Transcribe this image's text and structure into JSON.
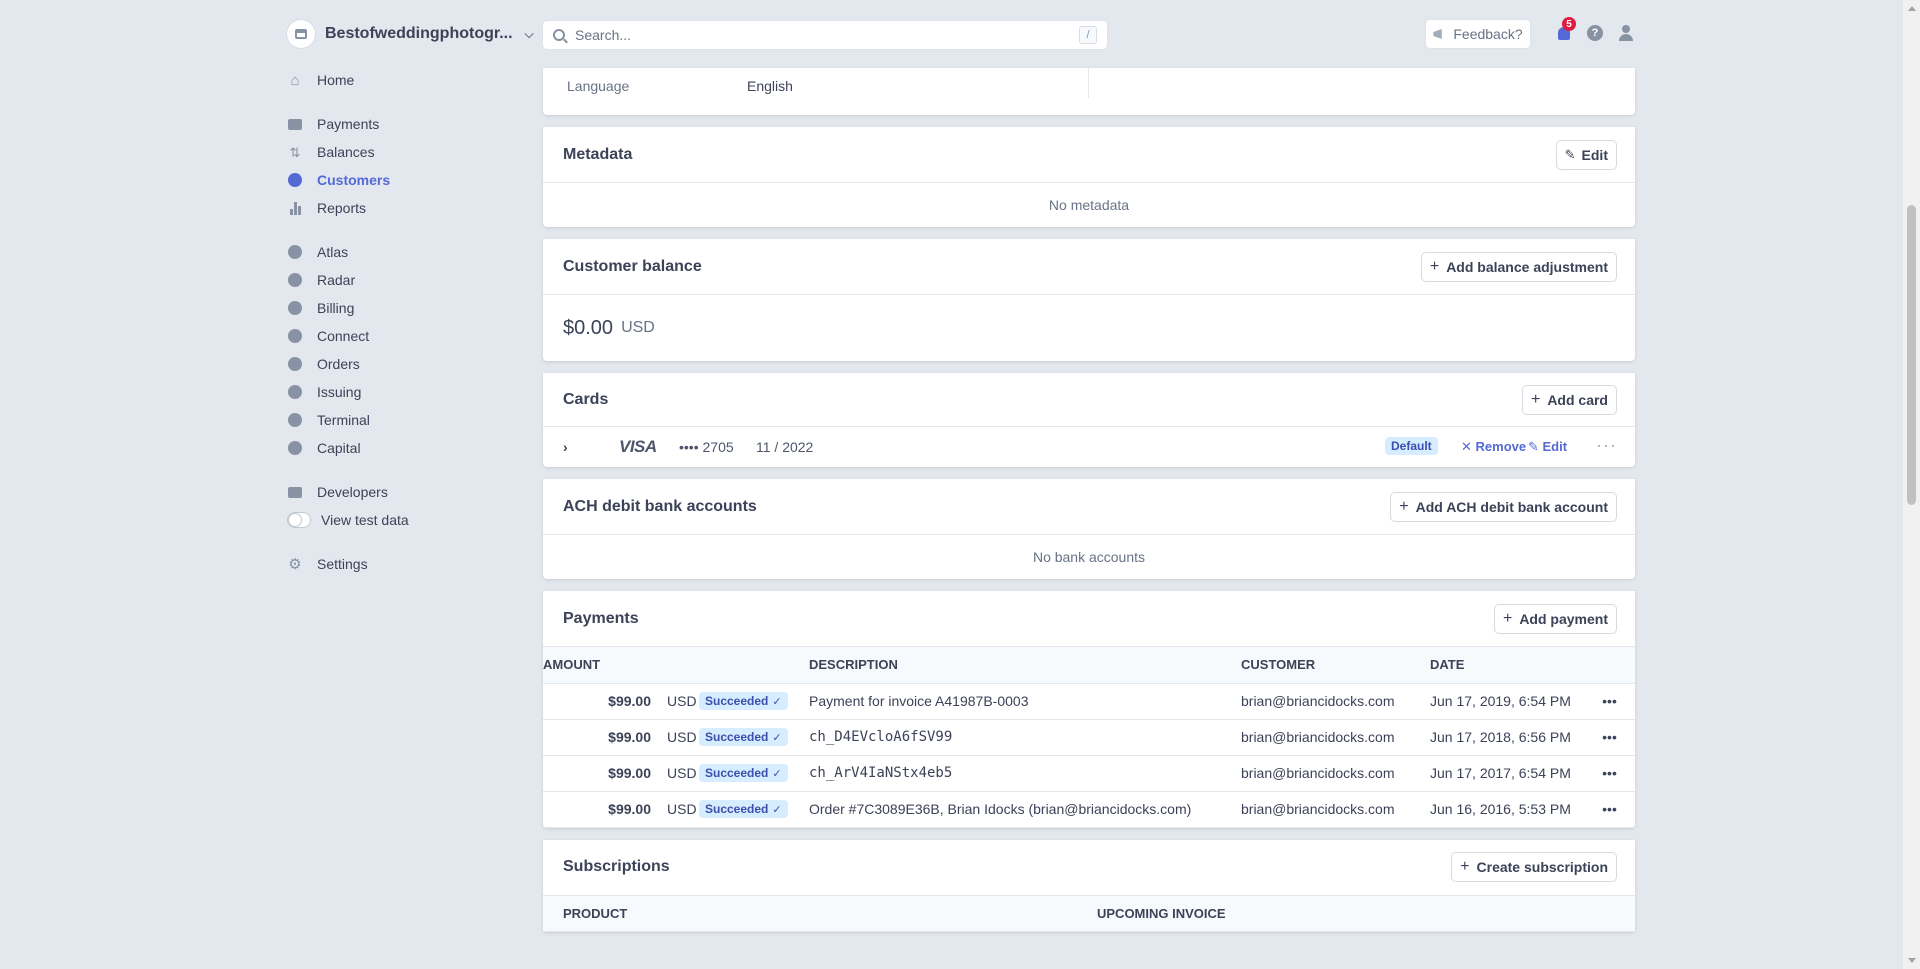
{
  "account": {
    "name": "Bestofweddingphotogr..."
  },
  "search": {
    "placeholder": "Search...",
    "shortcut": "/"
  },
  "topbar": {
    "feedback": "Feedback?",
    "notification_count": "5",
    "help": "?"
  },
  "sidebar": {
    "groups": [
      [
        {
          "label": "Home",
          "icon": "home-icon"
        }
      ],
      [
        {
          "label": "Payments",
          "icon": "payments-icon"
        },
        {
          "label": "Balances",
          "icon": "balances-icon"
        },
        {
          "label": "Customers",
          "icon": "customers-icon",
          "active": true
        },
        {
          "label": "Reports",
          "icon": "reports-icon"
        }
      ],
      [
        {
          "label": "Atlas",
          "icon": "atlas-icon"
        },
        {
          "label": "Radar",
          "icon": "radar-icon"
        },
        {
          "label": "Billing",
          "icon": "billing-icon"
        },
        {
          "label": "Connect",
          "icon": "connect-icon"
        },
        {
          "label": "Orders",
          "icon": "orders-icon"
        },
        {
          "label": "Issuing",
          "icon": "issuing-icon"
        },
        {
          "label": "Terminal",
          "icon": "terminal-icon"
        },
        {
          "label": "Capital",
          "icon": "capital-icon"
        }
      ],
      [
        {
          "label": "Developers",
          "icon": "developers-icon"
        },
        {
          "label": "View test data",
          "icon": "toggle"
        }
      ],
      [
        {
          "label": "Settings",
          "icon": "gear-icon"
        }
      ]
    ]
  },
  "details": {
    "language_label": "Language",
    "language_value": "English"
  },
  "metadata": {
    "title": "Metadata",
    "edit": "Edit",
    "empty": "No metadata"
  },
  "balance": {
    "title": "Customer balance",
    "add": "Add balance adjustment",
    "amount": "$0.00",
    "currency": "USD"
  },
  "cards": {
    "title": "Cards",
    "add": "Add card",
    "items": [
      {
        "brand": "VISA",
        "last4": "•••• 2705",
        "expiry": "11 / 2022",
        "badge": "Default",
        "remove": "Remove",
        "edit": "Edit"
      }
    ]
  },
  "ach": {
    "title": "ACH debit bank accounts",
    "add": "Add ACH debit bank account",
    "empty": "No bank accounts"
  },
  "payments": {
    "title": "Payments",
    "add": "Add payment",
    "columns": {
      "amount": "AMOUNT",
      "description": "DESCRIPTION",
      "customer": "CUSTOMER",
      "date": "DATE"
    },
    "rows": [
      {
        "amount": "$99.00",
        "currency": "USD",
        "status": "Succeeded",
        "description": "Payment for invoice A41987B-0003",
        "mono": false,
        "customer": "brian@briancidocks.com",
        "date": "Jun 17, 2019, 6:54 PM"
      },
      {
        "amount": "$99.00",
        "currency": "USD",
        "status": "Succeeded",
        "description": "ch_D4EVcloA6fSV99",
        "mono": true,
        "customer": "brian@briancidocks.com",
        "date": "Jun 17, 2018, 6:56 PM"
      },
      {
        "amount": "$99.00",
        "currency": "USD",
        "status": "Succeeded",
        "description": "ch_ArV4IaNStx4eb5",
        "mono": true,
        "customer": "brian@briancidocks.com",
        "date": "Jun 17, 2017, 6:54 PM"
      },
      {
        "amount": "$99.00",
        "currency": "USD",
        "status": "Succeeded",
        "description": "Order #7C3089E36B, Brian Idocks (brian@briancidocks.com)",
        "mono": false,
        "customer": "brian@briancidocks.com",
        "date": "Jun 16, 2016, 5:53 PM"
      }
    ]
  },
  "subscriptions": {
    "title": "Subscriptions",
    "add": "Create subscription",
    "columns": {
      "product": "PRODUCT",
      "upcoming": "UPCOMING INVOICE"
    }
  },
  "colors": {
    "accent": "#5469d4",
    "background": "#e3e8ee",
    "success_bg": "#cbf4c9"
  }
}
